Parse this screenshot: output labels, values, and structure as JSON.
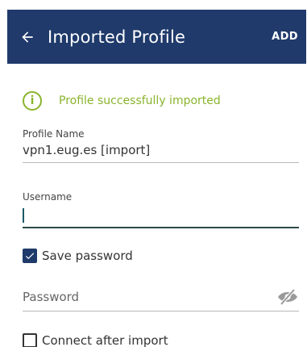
{
  "appbar": {
    "title": "Imported Profile",
    "add_label": "ADD",
    "background_color": "#1f3a6b"
  },
  "status": {
    "icon": "info-icon",
    "text": "Profile successfully imported",
    "color": "#8ab42d"
  },
  "profile_name": {
    "label": "Profile Name",
    "value": "vpn1.eug.es [import]"
  },
  "username": {
    "label": "Username",
    "value": ""
  },
  "save_password": {
    "label": "Save password",
    "checked": true
  },
  "password": {
    "placeholder": "Password",
    "value": "",
    "visibility_icon": "eye-off-icon"
  },
  "connect_after_import": {
    "label": "Connect after import",
    "checked": false
  }
}
